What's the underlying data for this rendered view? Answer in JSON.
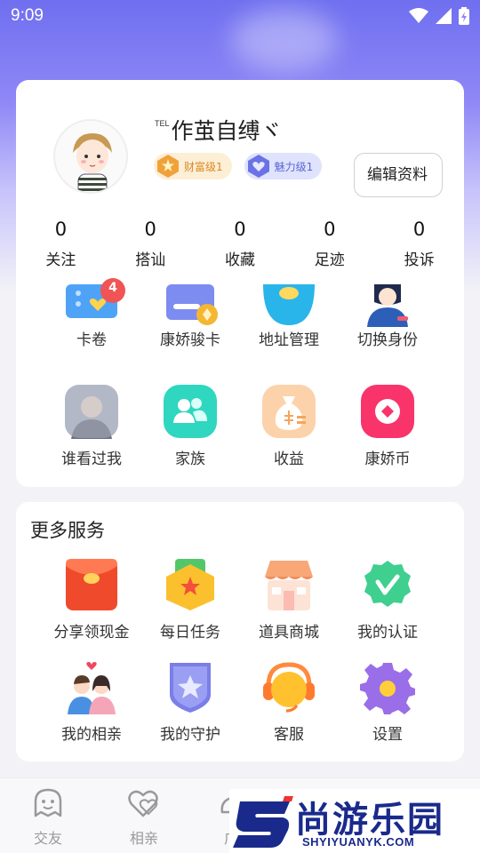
{
  "status_bar": {
    "time": "9:09"
  },
  "profile": {
    "tel_mark": "TEL",
    "nickname": "作茧自缚ヾ",
    "wealth_badge": "财富级1",
    "charm_badge": "魅力级1",
    "edit_label": "编辑资料",
    "stats": [
      {
        "count": "0",
        "label": "关注"
      },
      {
        "count": "0",
        "label": "搭讪"
      },
      {
        "count": "0",
        "label": "收藏"
      },
      {
        "count": "0",
        "label": "足迹"
      },
      {
        "count": "0",
        "label": "投诉"
      }
    ]
  },
  "tools": {
    "items": [
      {
        "label": "卡卷",
        "badge": "4",
        "icon": "ticket-icon"
      },
      {
        "label": "康娇骏卡",
        "icon": "card-icon"
      },
      {
        "label": "地址管理",
        "icon": "location-icon"
      },
      {
        "label": "切换身份",
        "icon": "identity-icon"
      },
      {
        "label": "谁看过我",
        "icon": "visitor-avatar-icon"
      },
      {
        "label": "家族",
        "icon": "family-icon"
      },
      {
        "label": "收益",
        "icon": "money-bag-icon"
      },
      {
        "label": "康娇币",
        "icon": "coin-icon"
      }
    ]
  },
  "services": {
    "title": "更多服务",
    "items": [
      {
        "label": "分享领现金",
        "icon": "red-envelope-icon"
      },
      {
        "label": "每日任务",
        "icon": "task-icon"
      },
      {
        "label": "道具商城",
        "icon": "shop-icon"
      },
      {
        "label": "我的认证",
        "icon": "verified-icon"
      },
      {
        "label": "我的相亲",
        "icon": "couple-icon"
      },
      {
        "label": "我的守护",
        "icon": "shield-star-icon"
      },
      {
        "label": "客服",
        "icon": "customer-service-icon"
      },
      {
        "label": "设置",
        "icon": "settings-gear-icon"
      }
    ]
  },
  "bottom_nav": {
    "items": [
      {
        "label": "交友",
        "icon": "ghost-face-icon"
      },
      {
        "label": "相亲",
        "icon": "hearts-icon"
      },
      {
        "label": "广",
        "icon": "plaza-icon"
      }
    ]
  },
  "watermark": {
    "title": "尚游乐园",
    "subtitle": "SHYIYUANYK.COM"
  },
  "colors": {
    "accent": "#7b78f2",
    "wealth": "#f0a23a",
    "charm": "#6a72e6",
    "badge_red": "#f05454"
  }
}
